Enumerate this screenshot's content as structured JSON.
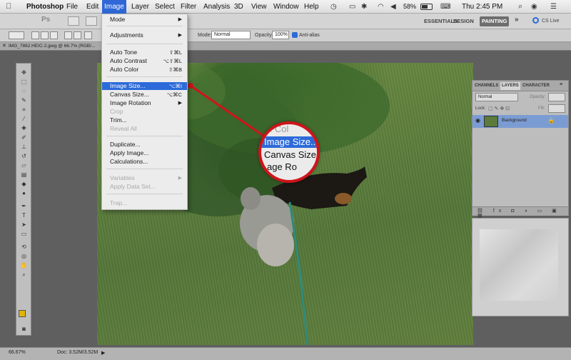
{
  "menubar": {
    "app": "Photoshop",
    "menus": [
      "File",
      "Edit",
      "Image",
      "Layer",
      "Select",
      "Filter",
      "Analysis",
      "3D",
      "View",
      "Window",
      "Help"
    ],
    "active": "Image",
    "battery": "58%",
    "clock": "Thu 2:45 PM"
  },
  "appbar": {
    "logo": "Ps",
    "workspaces": [
      "ESSENTIALS",
      "DESIGN",
      "PAINTING"
    ],
    "selected_workspace": "PAINTING",
    "more": "»",
    "cslive": "CS Live"
  },
  "options": {
    "mode_label": "Mode:",
    "mode_value": "Normal",
    "opacity_label": "Opacity:",
    "opacity_value": "100%",
    "antialias_label": "Anti-alias"
  },
  "document": {
    "tab_title": "IMG_7862.HEIC-2.jpeg @ 66.7% (RGB/...",
    "zoom": "66.67%",
    "doc_size": "Doc: 3.52M/3.52M"
  },
  "image_menu": {
    "items": [
      {
        "label": "Mode",
        "shortcut": "",
        "submenu": true,
        "disabled": false
      },
      {
        "label": "Adjustments",
        "shortcut": "",
        "submenu": true,
        "disabled": false
      },
      {
        "label": "Auto Tone",
        "shortcut": "⇧⌘L",
        "submenu": false,
        "disabled": false
      },
      {
        "label": "Auto Contrast",
        "shortcut": "⌥⇧⌘L",
        "submenu": false,
        "disabled": false
      },
      {
        "label": "Auto Color",
        "shortcut": "⇧⌘B",
        "submenu": false,
        "disabled": false
      },
      {
        "label": "Image Size...",
        "shortcut": "⌥⌘I",
        "submenu": false,
        "disabled": false,
        "highlighted": true
      },
      {
        "label": "Canvas Size...",
        "shortcut": "⌥⌘C",
        "submenu": false,
        "disabled": false
      },
      {
        "label": "Image Rotation",
        "shortcut": "",
        "submenu": true,
        "disabled": false
      },
      {
        "label": "Crop",
        "shortcut": "",
        "submenu": false,
        "disabled": true
      },
      {
        "label": "Trim...",
        "shortcut": "",
        "submenu": false,
        "disabled": false
      },
      {
        "label": "Reveal All",
        "shortcut": "",
        "submenu": false,
        "disabled": true
      },
      {
        "label": "Duplicate...",
        "shortcut": "",
        "submenu": false,
        "disabled": false
      },
      {
        "label": "Apply Image...",
        "shortcut": "",
        "submenu": false,
        "disabled": false
      },
      {
        "label": "Calculations...",
        "shortcut": "",
        "submenu": false,
        "disabled": false
      },
      {
        "label": "Variables",
        "shortcut": "",
        "submenu": true,
        "disabled": true
      },
      {
        "label": "Apply Data Set...",
        "shortcut": "",
        "submenu": false,
        "disabled": true
      },
      {
        "label": "Trap...",
        "shortcut": "",
        "submenu": false,
        "disabled": true
      }
    ]
  },
  "magnifier": {
    "lines": [
      "o Col",
      "Image Size..",
      "Canvas Size",
      "age Ro"
    ]
  },
  "layers_panel": {
    "tabs": [
      "CHANNELS",
      "LAYERS",
      "CHARACTER"
    ],
    "active_tab": "LAYERS",
    "blend_mode": "Normal",
    "opacity_label": "Opacity:",
    "lock_label": "Lock:",
    "fill_label": "Fill:",
    "layer_name": "Background",
    "bottom_icons": "⛓ fx ◘ ◑ ▭ ▣ 🗑"
  },
  "colors": {
    "accent": "#2d6ad9",
    "callout": "#d0141a",
    "fg_swatch": "#e4b400",
    "bg_swatch": "#111111"
  }
}
